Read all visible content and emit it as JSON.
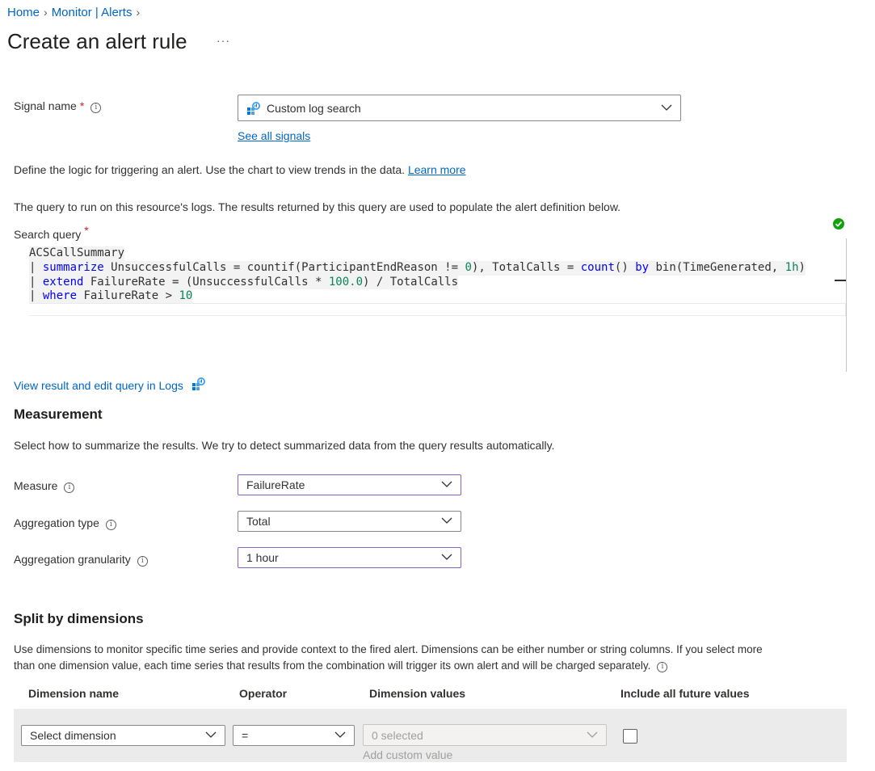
{
  "breadcrumb": {
    "items": [
      "Home",
      "Monitor | Alerts"
    ]
  },
  "page": {
    "title": "Create an alert rule",
    "more": "···"
  },
  "signal": {
    "label": "Signal name",
    "required_mark": "*",
    "info": "i",
    "selected": "Custom log search",
    "see_all": "See all signals"
  },
  "logic": {
    "text": "Define the logic for triggering an alert. Use the chart to view trends in the data.",
    "learn_more": "Learn more"
  },
  "query": {
    "description": "The query to run on this resource's logs. The results returned by this query are used to populate the alert definition below.",
    "label": "Search query",
    "required_mark": "*",
    "lines": [
      "ACSCallSummary",
      "| summarize UnsuccessfulCalls = countif(ParticipantEndReason != 0), TotalCalls = count() by bin(TimeGenerated, 1h)",
      "| extend FailureRate = (UnsuccessfulCalls * 100.0) / TotalCalls",
      "| where FailureRate > 10"
    ],
    "view_in_logs": "View result and edit query in Logs"
  },
  "measurement": {
    "title": "Measurement",
    "description": "Select how to summarize the results. We try to detect summarized data from the query results automatically.",
    "measure_label": "Measure",
    "measure_value": "FailureRate",
    "aggregation_type_label": "Aggregation type",
    "aggregation_type_value": "Total",
    "granularity_label": "Aggregation granularity",
    "granularity_value": "1 hour"
  },
  "split": {
    "title": "Split by dimensions",
    "description_1": "Use dimensions to monitor specific time series and provide context to the fired alert. Dimensions can be either number or string columns. If you select more",
    "description_2": "than one dimension value, each time series that results from the combination will trigger its own alert and will be charged separately.",
    "columns": [
      "Dimension name",
      "Operator",
      "Dimension values",
      "Include all future values"
    ],
    "row": {
      "dimension_placeholder": "Select dimension",
      "operator": "=",
      "values_placeholder": "0 selected",
      "add_custom": "Add custom value"
    }
  },
  "colors": {
    "link": "#0066c6",
    "required": "#c4262c",
    "focus_border": "#8661c5",
    "valid": "#13a10e"
  }
}
